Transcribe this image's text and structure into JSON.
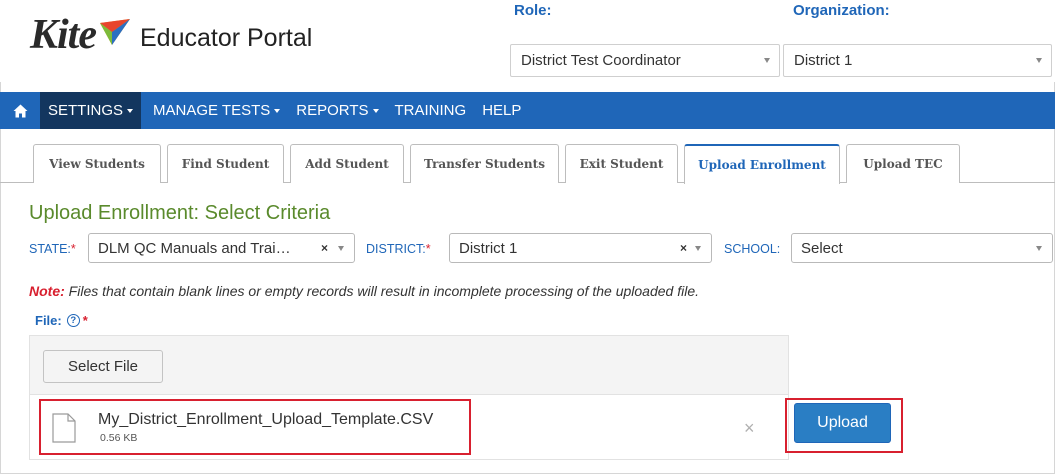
{
  "app": {
    "logo_text": "Kite",
    "subtitle": "Educator Portal"
  },
  "header": {
    "role_label": "Role:",
    "role_value": "District Test Coordinator",
    "org_label": "Organization:",
    "org_value": "District 1"
  },
  "nav": {
    "home_icon": "home-icon",
    "items": [
      {
        "label": "SETTINGS",
        "dropdown": true,
        "active": true
      },
      {
        "label": "MANAGE TESTS",
        "dropdown": true,
        "active": false
      },
      {
        "label": "REPORTS",
        "dropdown": true,
        "active": false
      },
      {
        "label": "TRAINING",
        "dropdown": false,
        "active": false
      },
      {
        "label": "HELP",
        "dropdown": false,
        "active": false
      }
    ]
  },
  "tabs": [
    {
      "label": "View Students",
      "active": false
    },
    {
      "label": "Find Student",
      "active": false
    },
    {
      "label": "Add Student",
      "active": false
    },
    {
      "label": "Transfer Students",
      "active": false
    },
    {
      "label": "Exit Student",
      "active": false
    },
    {
      "label": "Upload Enrollment",
      "active": true
    },
    {
      "label": "Upload TEC",
      "active": false
    }
  ],
  "page": {
    "title": "Upload Enrollment: Select Criteria",
    "state_label": "STATE:",
    "state_value": "DLM QC Manuals and Trai…",
    "district_label": "DISTRICT:",
    "district_value": "District 1",
    "school_label": "SCHOOL:",
    "school_value": "Select",
    "required_mark": "*",
    "note_label": "Note:",
    "note_text": " Files that contain blank lines or empty records will result in incomplete processing of the uploaded file.",
    "file_label": "File:",
    "help_glyph": "?",
    "select_file_button": "Select File",
    "file_name": "My_District_Enrollment_Upload_Template.CSV",
    "file_size": "0.56 KB",
    "remove_glyph": "×",
    "clear_glyph": "×",
    "upload_button": "Upload"
  },
  "colors": {
    "brand_blue": "#1f66b8",
    "nav_active": "#13365f",
    "title_green": "#5a8a2c",
    "required_red": "#d8202f",
    "upload_button": "#2a7ec4",
    "highlight_red": "#d8202f"
  }
}
